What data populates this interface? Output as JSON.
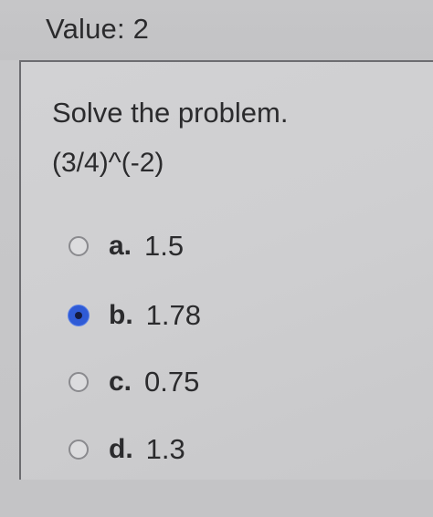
{
  "header": {
    "value_label": "Value: 2"
  },
  "question": {
    "prompt": "Solve the problem.",
    "expression": "(3/4)^(-2)"
  },
  "options": [
    {
      "letter": "a.",
      "value": "1.5",
      "selected": false
    },
    {
      "letter": "b.",
      "value": "1.78",
      "selected": true
    },
    {
      "letter": "c.",
      "value": "0.75",
      "selected": false
    },
    {
      "letter": "d.",
      "value": "1.3",
      "selected": false
    }
  ],
  "colors": {
    "selected_radio": "#2f5bd6"
  }
}
